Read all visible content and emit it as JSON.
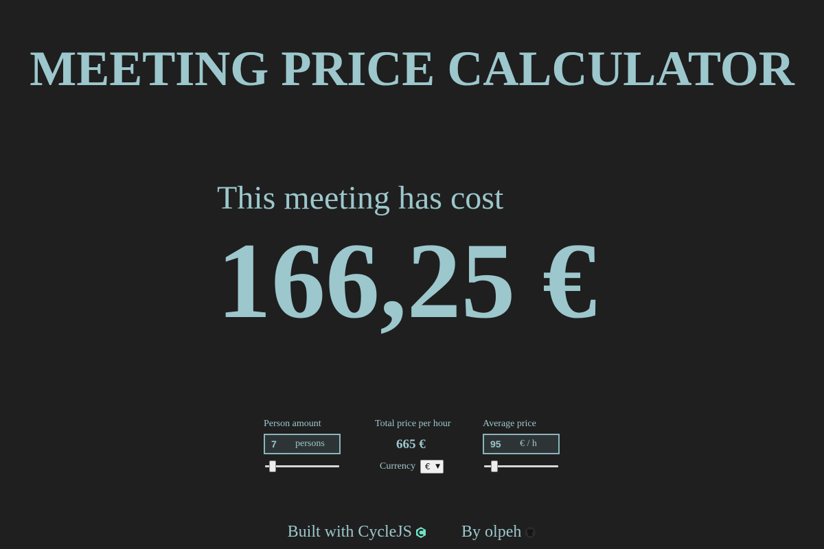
{
  "header": {
    "title": "MEETING PRICE CALCULATOR"
  },
  "main": {
    "cost_label": "This meeting has cost",
    "cost_value": "166,25 €"
  },
  "controls": {
    "person_amount": {
      "label": "Person amount",
      "value": "7",
      "unit": "persons",
      "slider_fraction": 0.06
    },
    "total": {
      "label": "Total price per hour",
      "value": "665 €",
      "currency_label": "Currency",
      "currency_selected": "€"
    },
    "average_price": {
      "label": "Average price",
      "value": "95",
      "unit": "€ / h",
      "slider_fraction": 0.1
    }
  },
  "footer": {
    "built_with": "Built with CycleJS",
    "by": "By olpeh",
    "icons": [
      "cyclejs-logo-icon",
      "github-icon"
    ]
  },
  "colors": {
    "background": "#1f1f1f",
    "accent": "#9cc7cc"
  }
}
